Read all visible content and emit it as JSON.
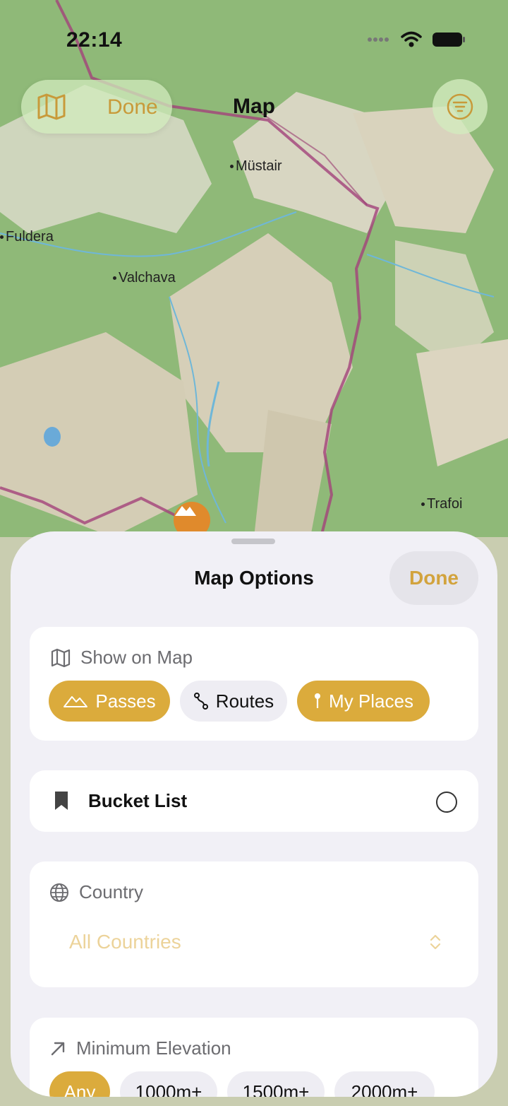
{
  "status_bar": {
    "time": "22:14"
  },
  "nav": {
    "left_done": "Done",
    "title": "Map"
  },
  "map": {
    "places": [
      "Müstair",
      "Fuldera",
      "Valchava",
      "Trafoi"
    ]
  },
  "sheet": {
    "title": "Map Options",
    "done_label": "Done",
    "show_on_map": {
      "header": "Show on Map",
      "chips": [
        {
          "label": "Passes",
          "selected": true
        },
        {
          "label": "Routes",
          "selected": false
        },
        {
          "label": "My Places",
          "selected": true
        }
      ]
    },
    "bucket_list": {
      "label": "Bucket List",
      "checked": false
    },
    "country": {
      "header": "Country",
      "value": "All Countries"
    },
    "min_elevation": {
      "header": "Minimum Elevation",
      "options": [
        {
          "label": "Any",
          "selected": true
        },
        {
          "label": "1000m+",
          "selected": false
        },
        {
          "label": "1500m+",
          "selected": false
        },
        {
          "label": "2000m+",
          "selected": false
        }
      ]
    }
  },
  "colors": {
    "accent": "#dbab3c",
    "sheet_bg": "#f1f0f6",
    "pin": "#e08a2c"
  }
}
